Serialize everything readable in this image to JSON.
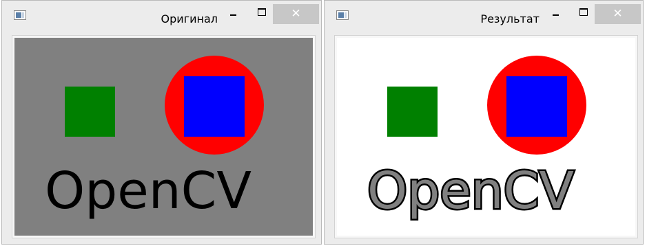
{
  "windows": [
    {
      "title": "Оригинал",
      "close_glyph": "✕",
      "image": {
        "background_color": "#808080",
        "square_color": "#008000",
        "circle_color": "#ff0000",
        "inner_square_color": "#0000ff",
        "text": "OpenCV",
        "text_color": "#000000"
      }
    },
    {
      "title": "Результат",
      "close_glyph": "✕",
      "image": {
        "background_color": "#ffffff",
        "square_color": "#008000",
        "circle_color": "#ff0000",
        "inner_square_color": "#0000ff",
        "text": "OpenCV",
        "text_color": "#000000",
        "letter_fill_color": "#808080"
      }
    }
  ],
  "icons": {
    "app": "app-window-icon",
    "minimize": "minimize-icon",
    "maximize": "maximize-icon",
    "close": "close-icon"
  }
}
